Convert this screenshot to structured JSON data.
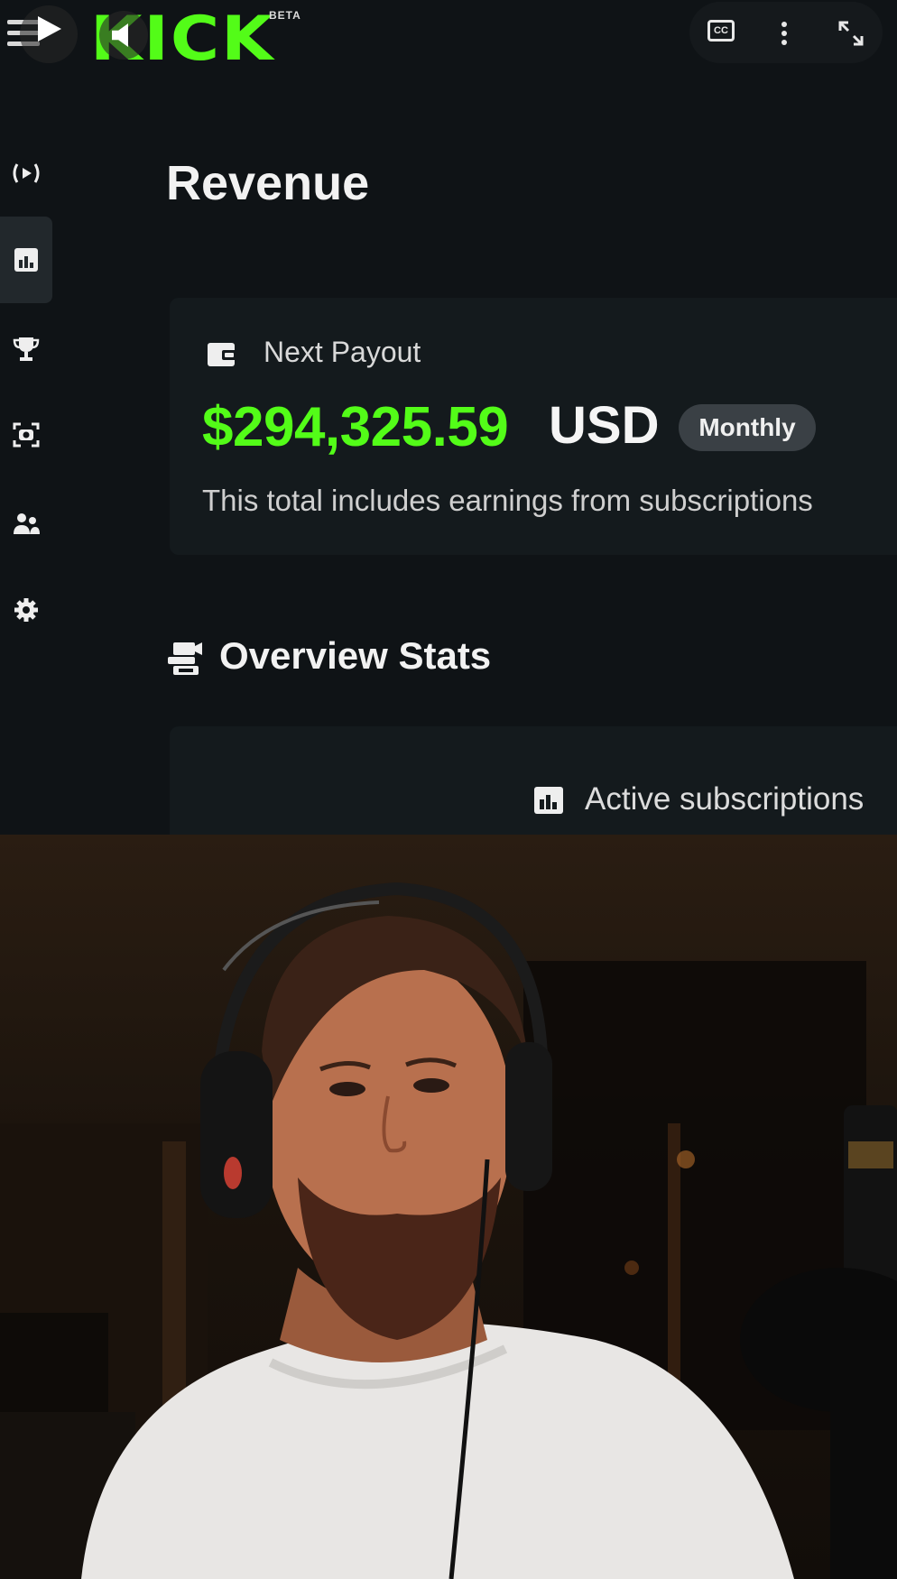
{
  "player": {
    "logo_text": "KICK",
    "logo_badge": "BETA",
    "cc_label": "CC"
  },
  "rail": {
    "items": [
      {
        "icon": "live-icon",
        "active": false
      },
      {
        "icon": "analytics-icon",
        "active": true
      },
      {
        "icon": "trophy-icon",
        "active": false
      },
      {
        "icon": "camera-icon",
        "active": false
      },
      {
        "icon": "users-icon",
        "active": false
      },
      {
        "icon": "settings-icon",
        "active": false
      }
    ]
  },
  "page": {
    "title": "Revenue"
  },
  "payout": {
    "label": "Next Payout",
    "amount": "$294,325.59",
    "currency": "USD",
    "period_badge": "Monthly",
    "note": "This total includes earnings from subscriptions"
  },
  "overview": {
    "title": "Overview Stats",
    "stat_label": "Active subscriptions"
  },
  "colors": {
    "accent": "#53fc18",
    "background": "#0f1316",
    "card": "#141a1d"
  }
}
